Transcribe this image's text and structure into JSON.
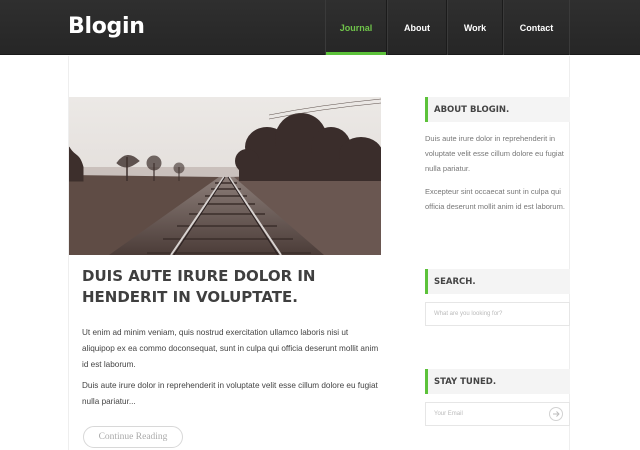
{
  "header": {
    "brand": "Blogin",
    "nav": [
      {
        "label": "Journal",
        "active": true
      },
      {
        "label": "About",
        "active": false
      },
      {
        "label": "Work",
        "active": false
      },
      {
        "label": "Contact",
        "active": false
      }
    ]
  },
  "post": {
    "title": "DUIS AUTE IRURE DOLOR IN HENDERIT IN VOLUPTATE.",
    "paragraph_1": "Ut enim ad minim veniam, quis nostrud exercitation ullamco laboris nisi ut aliquipop ex ea commo doconsequat, sunt in culpa qui officia deserunt mollit anim id est laborum.",
    "paragraph_2": "Duis aute irure dolor in reprehenderit in voluptate velit esse cillum dolore eu fugiat nulla pariatur...",
    "read_more": "Continue Reading"
  },
  "sidebar": {
    "about_title": "ABOUT BLOGIN.",
    "about_text_1": "Duis aute irure dolor in reprehenderit in voluptate velit esse cillum dolore eu fugiat nulla pariatur.",
    "about_text_2": "Excepteur sint occaecat sunt in culpa qui officia deserunt mollit anim id est laborum.",
    "search_title": "SEARCH.",
    "search_placeholder": "What are you looking for?",
    "stay_title": "STAY TUNED.",
    "email_placeholder": "Your Email"
  },
  "colors": {
    "accent": "#5cc23a",
    "header_bg": "#2a2a2a"
  }
}
